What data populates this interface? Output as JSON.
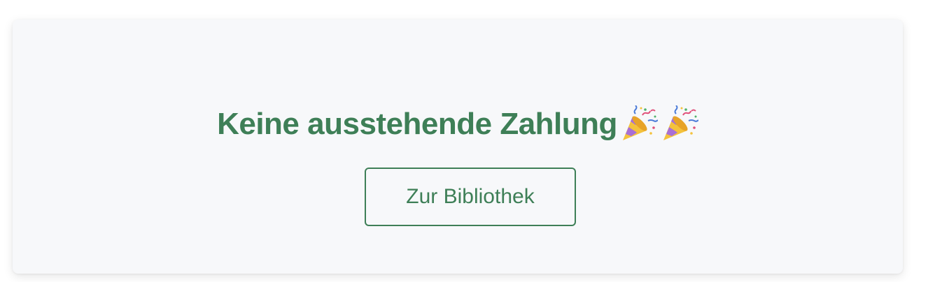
{
  "status": {
    "headline": "Keine ausstehende Zahlung",
    "emoji_icons": [
      "party-popper-icon",
      "party-popper-icon"
    ]
  },
  "actions": {
    "library_button_label": "Zur Bibliothek"
  },
  "colors": {
    "accent": "#3e7f57",
    "card_background": "#f7f8fa",
    "page_background": "#ffffff"
  }
}
